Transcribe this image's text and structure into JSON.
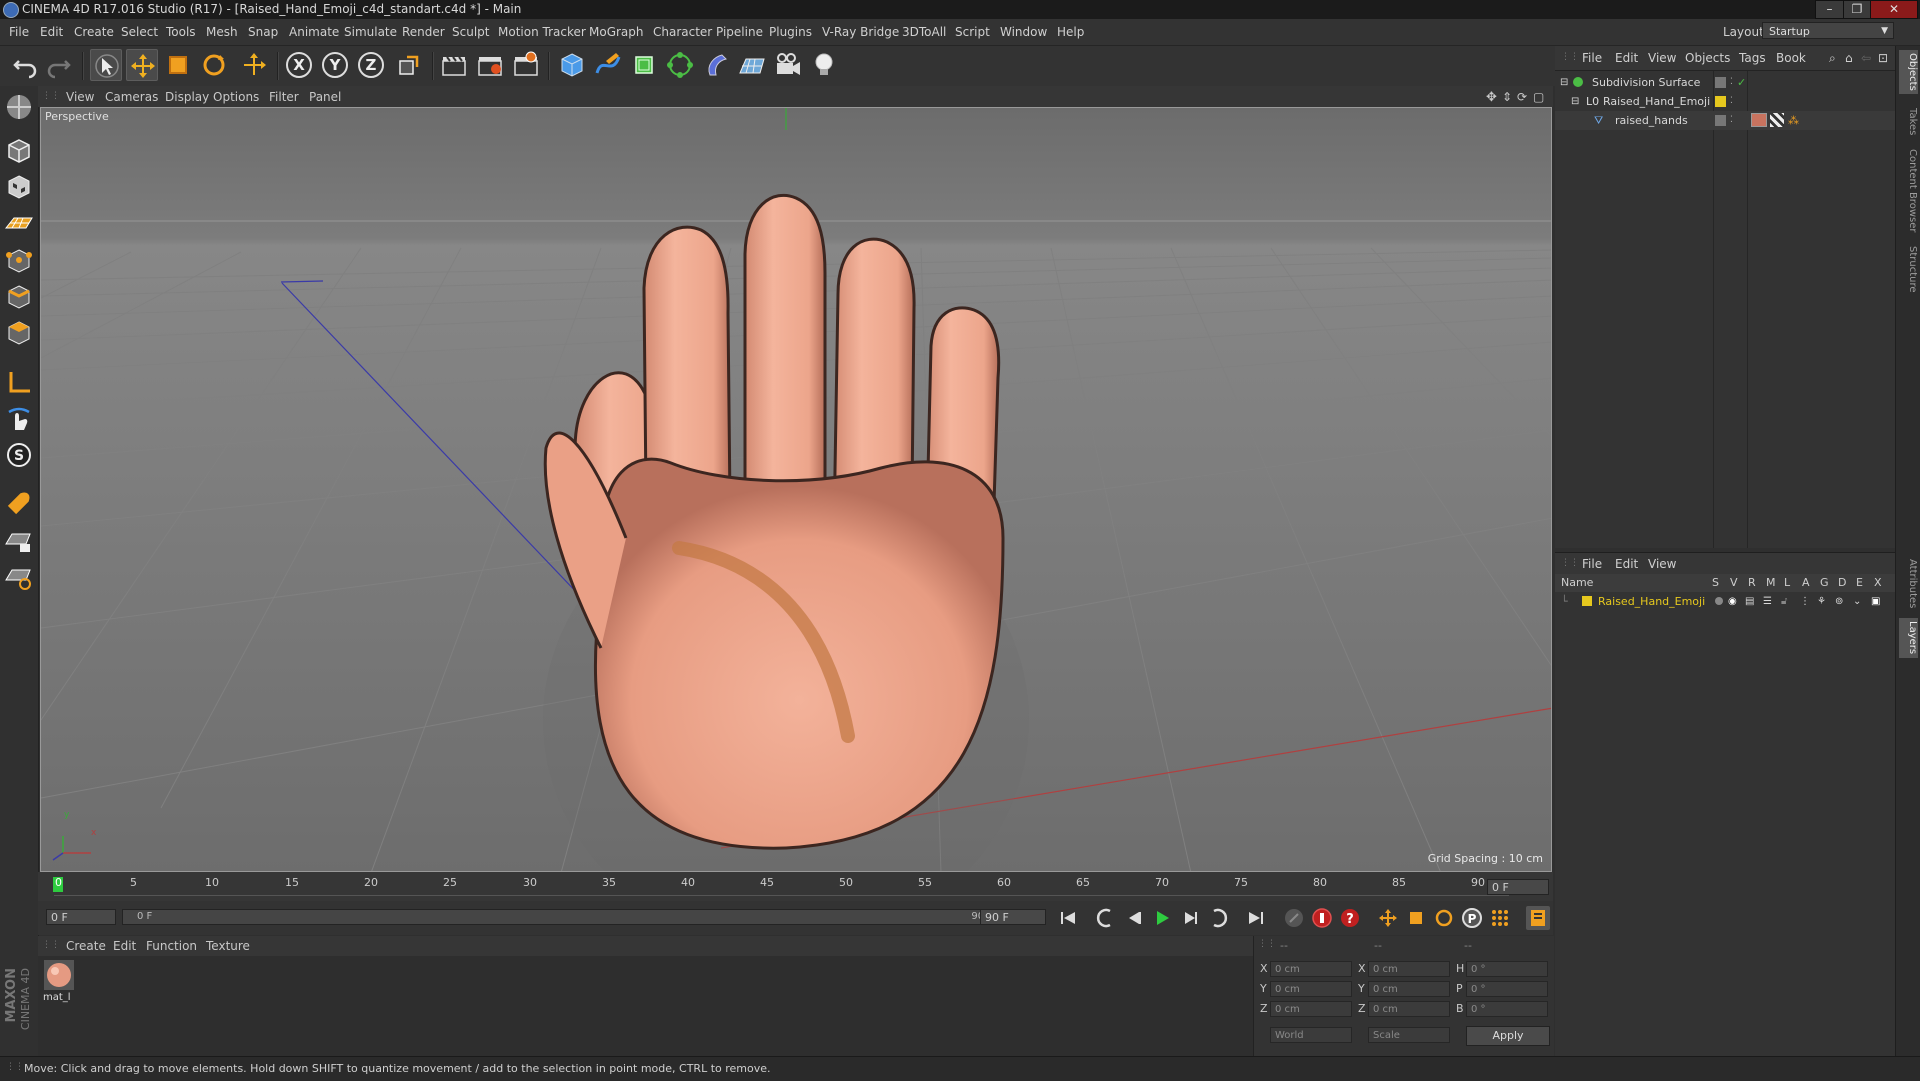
{
  "window": {
    "title": "CINEMA 4D R17.016 Studio (R17) - [Raised_Hand_Emoji_c4d_standart.c4d *] - Main",
    "controls": [
      "–",
      "❐",
      "✕"
    ]
  },
  "menubar": {
    "items": [
      "File",
      "Edit",
      "Create",
      "Select",
      "Tools",
      "Mesh",
      "Snap",
      "Animate",
      "Simulate",
      "Render",
      "Sculpt",
      "Motion Tracker",
      "MoGraph",
      "Character",
      "Pipeline",
      "Plugins",
      "V-Ray Bridge",
      "3DToAll",
      "Script",
      "Window",
      "Help"
    ],
    "layout_label": "Layout:",
    "layout_value": "Startup"
  },
  "toolbar": {
    "axis": [
      "X",
      "Y",
      "Z"
    ]
  },
  "viewport": {
    "menu": [
      "View",
      "Cameras",
      "Display",
      "Options",
      "Filter",
      "Panel"
    ],
    "label": "Perspective",
    "grid_spacing": "Grid Spacing : 10 cm",
    "axis_x": "x",
    "axis_y": "y"
  },
  "timeline": {
    "ticks": [
      "0",
      "5",
      "10",
      "15",
      "20",
      "25",
      "30",
      "35",
      "40",
      "45",
      "50",
      "55",
      "60",
      "65",
      "70",
      "75",
      "80",
      "85",
      "90"
    ],
    "current_frame": "0 F",
    "start_field": "0 F",
    "range_start": "0 F",
    "range_end": "90 F",
    "end_field": "90 F"
  },
  "material_manager": {
    "menu": [
      "Create",
      "Edit",
      "Function",
      "Texture"
    ],
    "material_name": "mat_l"
  },
  "coordinates": {
    "headers": [
      "--",
      "--",
      "--"
    ],
    "rows": [
      {
        "a": "X",
        "av": "0 cm",
        "b": "X",
        "bv": "0 cm",
        "c": "H",
        "cv": "0 °"
      },
      {
        "a": "Y",
        "av": "0 cm",
        "b": "Y",
        "bv": "0 cm",
        "c": "P",
        "cv": "0 °"
      },
      {
        "a": "Z",
        "av": "0 cm",
        "b": "Z",
        "bv": "0 cm",
        "c": "B",
        "cv": "0 °"
      }
    ],
    "mode_world": "World",
    "mode_scale": "Scale",
    "apply": "Apply"
  },
  "object_manager": {
    "menu": [
      "File",
      "Edit",
      "View",
      "Objects",
      "Tags",
      "Book"
    ],
    "objects": [
      {
        "name": "Subdivision Surface",
        "indent": 0
      },
      {
        "name": "Raised_Hand_Emoji",
        "indent": 1
      },
      {
        "name": "raised_hands",
        "indent": 2
      }
    ]
  },
  "layer_manager": {
    "menu": [
      "File",
      "Edit",
      "View"
    ],
    "name_header": "Name",
    "flags": [
      "S",
      "V",
      "R",
      "M",
      "L",
      "A",
      "G",
      "D",
      "E",
      "X"
    ],
    "layers": [
      {
        "name": "Raised_Hand_Emoji",
        "color": "#e6c81e"
      }
    ]
  },
  "side_tabs": [
    "Objects",
    "Takes",
    "Content Browser",
    "Structure",
    "Attributes",
    "Layers"
  ],
  "branding": {
    "maxon": "MAXON",
    "product": "CINEMA 4D"
  },
  "status": "Move: Click and drag to move elements. Hold down SHIFT to quantize movement / add to the selection in point mode, CTRL to remove.",
  "colors": {
    "accent": "#3d8ee6",
    "skin": "#f0a68c",
    "layer": "#e6c81e"
  }
}
